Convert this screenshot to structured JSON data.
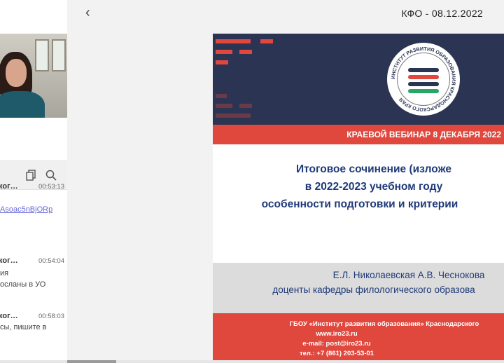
{
  "header": {
    "back_symbol": "‹",
    "title": "КФО - 08.12.2022"
  },
  "chat": {
    "toolbar_icons": [
      "copy-icon",
      "search-chat-icon"
    ],
    "messages": [
      {
        "name": "ког…",
        "time": "00:53:13",
        "lines": [
          "Asoac5nBjORp"
        ],
        "link": true
      },
      {
        "name": "ког…",
        "time": "00:54:04",
        "lines": [
          "ия",
          "осланы в УО"
        ],
        "link": false
      },
      {
        "name": "ког…",
        "time": "00:58:03",
        "lines": [
          "сы, пишите в"
        ],
        "link": false
      }
    ]
  },
  "slide": {
    "band_text": "КРАЕВОЙ ВЕБИНАР 8 ДЕКАБРЯ  2022",
    "logo_text": "ИНСТИТУТ РАЗВИТИЯ ОБРАЗОВАНИЯ КРАСНОДАРСКОГО КРАЯ",
    "title_lines": [
      "Итоговое сочинение (изложе",
      "в 2022-2023 учебном году",
      "особенности подготовки и критерии"
    ],
    "authors": "Е.Л. Николаевская А.В. Чеснокова",
    "position": "доценты кафедры филологического образова",
    "footer_lines": [
      "ГБОУ «Институт развития образования» Краснодарского",
      "www.iro23.ru",
      "e-mail: post@iro23.ru",
      "тел.: +7 (861) 203-53-01"
    ]
  },
  "colors": {
    "navy": "#2b3553",
    "red": "#e0473d",
    "title_blue": "#1f3a78"
  }
}
